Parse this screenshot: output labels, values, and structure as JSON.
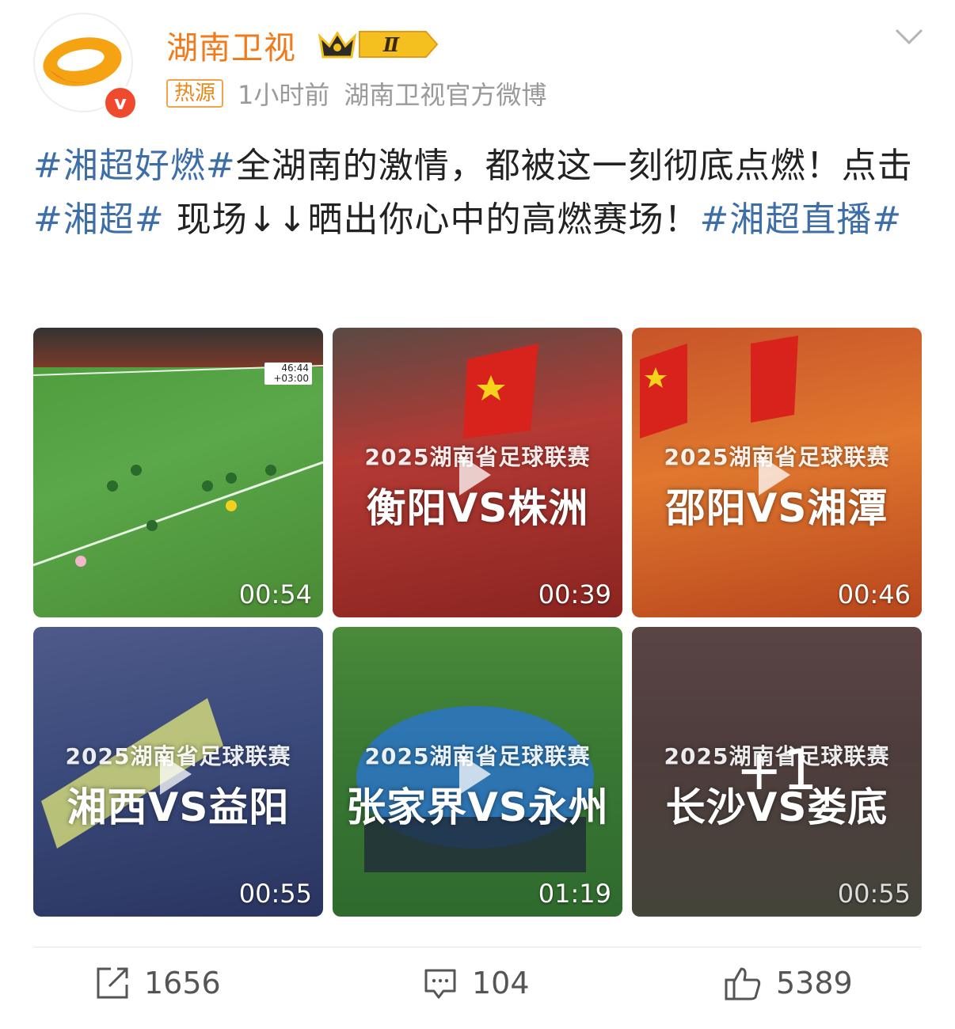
{
  "account": {
    "name": "湖南卫视",
    "avatar_icon": "mango-logo-icon",
    "verified_icon": "verified-v-icon",
    "hot_tag": "热源",
    "time": "1小时前",
    "source": "湖南卫视官方微博",
    "level_badge": "Ⅱ"
  },
  "post": {
    "segments": [
      {
        "text": "#湘超好燃#",
        "type": "tag"
      },
      {
        "text": "全湖南的激情，都被这一刻彻底点燃！点击",
        "type": "text"
      },
      {
        "text": "#湘超#",
        "type": "tag"
      },
      {
        "text": " 现场↓↓晒出你心中的高燃赛场！",
        "type": "text"
      },
      {
        "text": "#湘超直播#",
        "type": "tag"
      }
    ]
  },
  "media": [
    {
      "duration": "00:54",
      "title1": "",
      "title2": "",
      "scoreboard": "46:44\n+03:00"
    },
    {
      "duration": "00:39",
      "title1": "2025湖南省足球联赛",
      "title2": "衡阳VS株洲"
    },
    {
      "duration": "00:46",
      "title1": "2025湖南省足球联赛",
      "title2": "邵阳VS湘潭"
    },
    {
      "duration": "00:55",
      "title1": "2025湖南省足球联赛",
      "title2": "湘西VS益阳"
    },
    {
      "duration": "01:19",
      "title1": "2025湖南省足球联赛",
      "title2": "张家界VS永州"
    },
    {
      "duration": "00:55",
      "title1": "2025湖南省足球联赛",
      "title2": "长沙VS娄底",
      "more": "+1"
    }
  ],
  "actions": {
    "repost_count": "1656",
    "comment_count": "104",
    "like_count": "5389"
  },
  "colors": {
    "accent_name": "#f27a1a",
    "hashtag": "#3d6ea8",
    "meta": "#9a9a9a"
  }
}
